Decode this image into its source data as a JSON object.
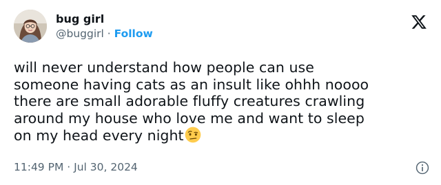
{
  "author": {
    "display_name": "bug girl",
    "handle": "@buggirl",
    "separator": "·",
    "follow_label": "Follow"
  },
  "tweet": {
    "lines": [
      "will never understand how people can use",
      "someone having cats as an insult like ohhh noooo",
      "there are small adorable fluffy creatures crawling",
      "around my house who love me and want to sleep",
      "on my head every night"
    ],
    "emoji": "face-with-raised-eyebrow"
  },
  "footer": {
    "time": "11:49 PM",
    "separator": "·",
    "date": "Jul 30, 2024"
  },
  "colors": {
    "text": "#0f1419",
    "secondary": "#536471",
    "accent": "#1d9bf0"
  },
  "icons": {
    "brand": "x-logo-icon",
    "info": "info-icon"
  }
}
